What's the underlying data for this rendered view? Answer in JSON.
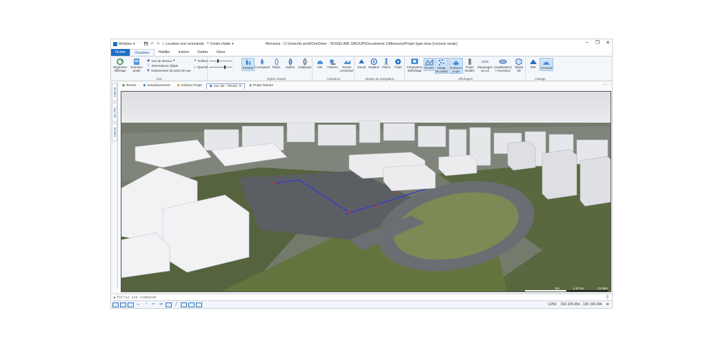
{
  "titlebar": {
    "modules_label": "Modules",
    "search_label": "Localiser une commande",
    "help_label": "Centre d'aide",
    "window_title": "Mensura - C:\\Users\\b.avril\\OneDrive - SOGELINK GROUP\\Documents 1\\Mensura\\Projet type.msa (Lecture seule)"
  },
  "ribbon_tabs": [
    "Fichier",
    "Visualiser",
    "Habiller",
    "Insérer",
    "Sorties",
    "Gérer"
  ],
  "ribbon": {
    "vue": {
      "label": "Vue",
      "regen": "Régénérer affichage",
      "donnees": "Données projet",
      "vue_dessus": "Vue de dessus",
      "infos": "Informations Objets",
      "gestionnaire": "Gestionnaire de point de vue"
    },
    "sliders": {
      "reflets": "Reflets",
      "opacite": "Opacité"
    },
    "styles": {
      "label": "Styles visuels",
      "items": [
        "Réaliste",
        "Conceptuel",
        "Filaire",
        "Stylisé",
        "Analytique"
      ]
    },
    "ambiance": {
      "label": "Ambiance",
      "items": [
        "Ciel",
        "Ombres",
        "Terrain contextuel"
      ]
    },
    "navigation": {
      "label": "Modes de navigation",
      "items": [
        "Survol",
        "Rotation",
        "Piéton",
        "Trajet"
      ]
    },
    "affichages": {
      "label": "Affichages",
      "items": [
        "Paramètres d'affichage",
        "Terrain",
        "Nuage de points",
        "Surfaces projet",
        "Projet linéaire",
        "Marquages au sol",
        "Canalisations / Fourreaux",
        "Objets 3D"
      ]
    },
    "lissage": {
      "label": "Lissage",
      "items": [
        "Plat",
        "Gouraud"
      ]
    }
  },
  "side_tabs": [
    "Entités",
    "Vue 3D",
    "Entités"
  ],
  "doc_tabs": [
    "Terrain",
    "Assainissement",
    "Surface Projet",
    "Vue 3D - Terrain",
    "Projet linéaire"
  ],
  "viewport": {
    "scale_start": "0m",
    "scale_mid": "4.671m",
    "scale_end": "23.36m"
  },
  "command": {
    "placeholder": "Entrez une commande"
  },
  "status": {
    "zoom": "1/256",
    "coords": "332 229.454 , 136 196.094"
  },
  "colors": {
    "accent": "#1f6fc5",
    "ribbon_bg": "#f3f6fa",
    "profile_line": "#3b3fbf"
  }
}
